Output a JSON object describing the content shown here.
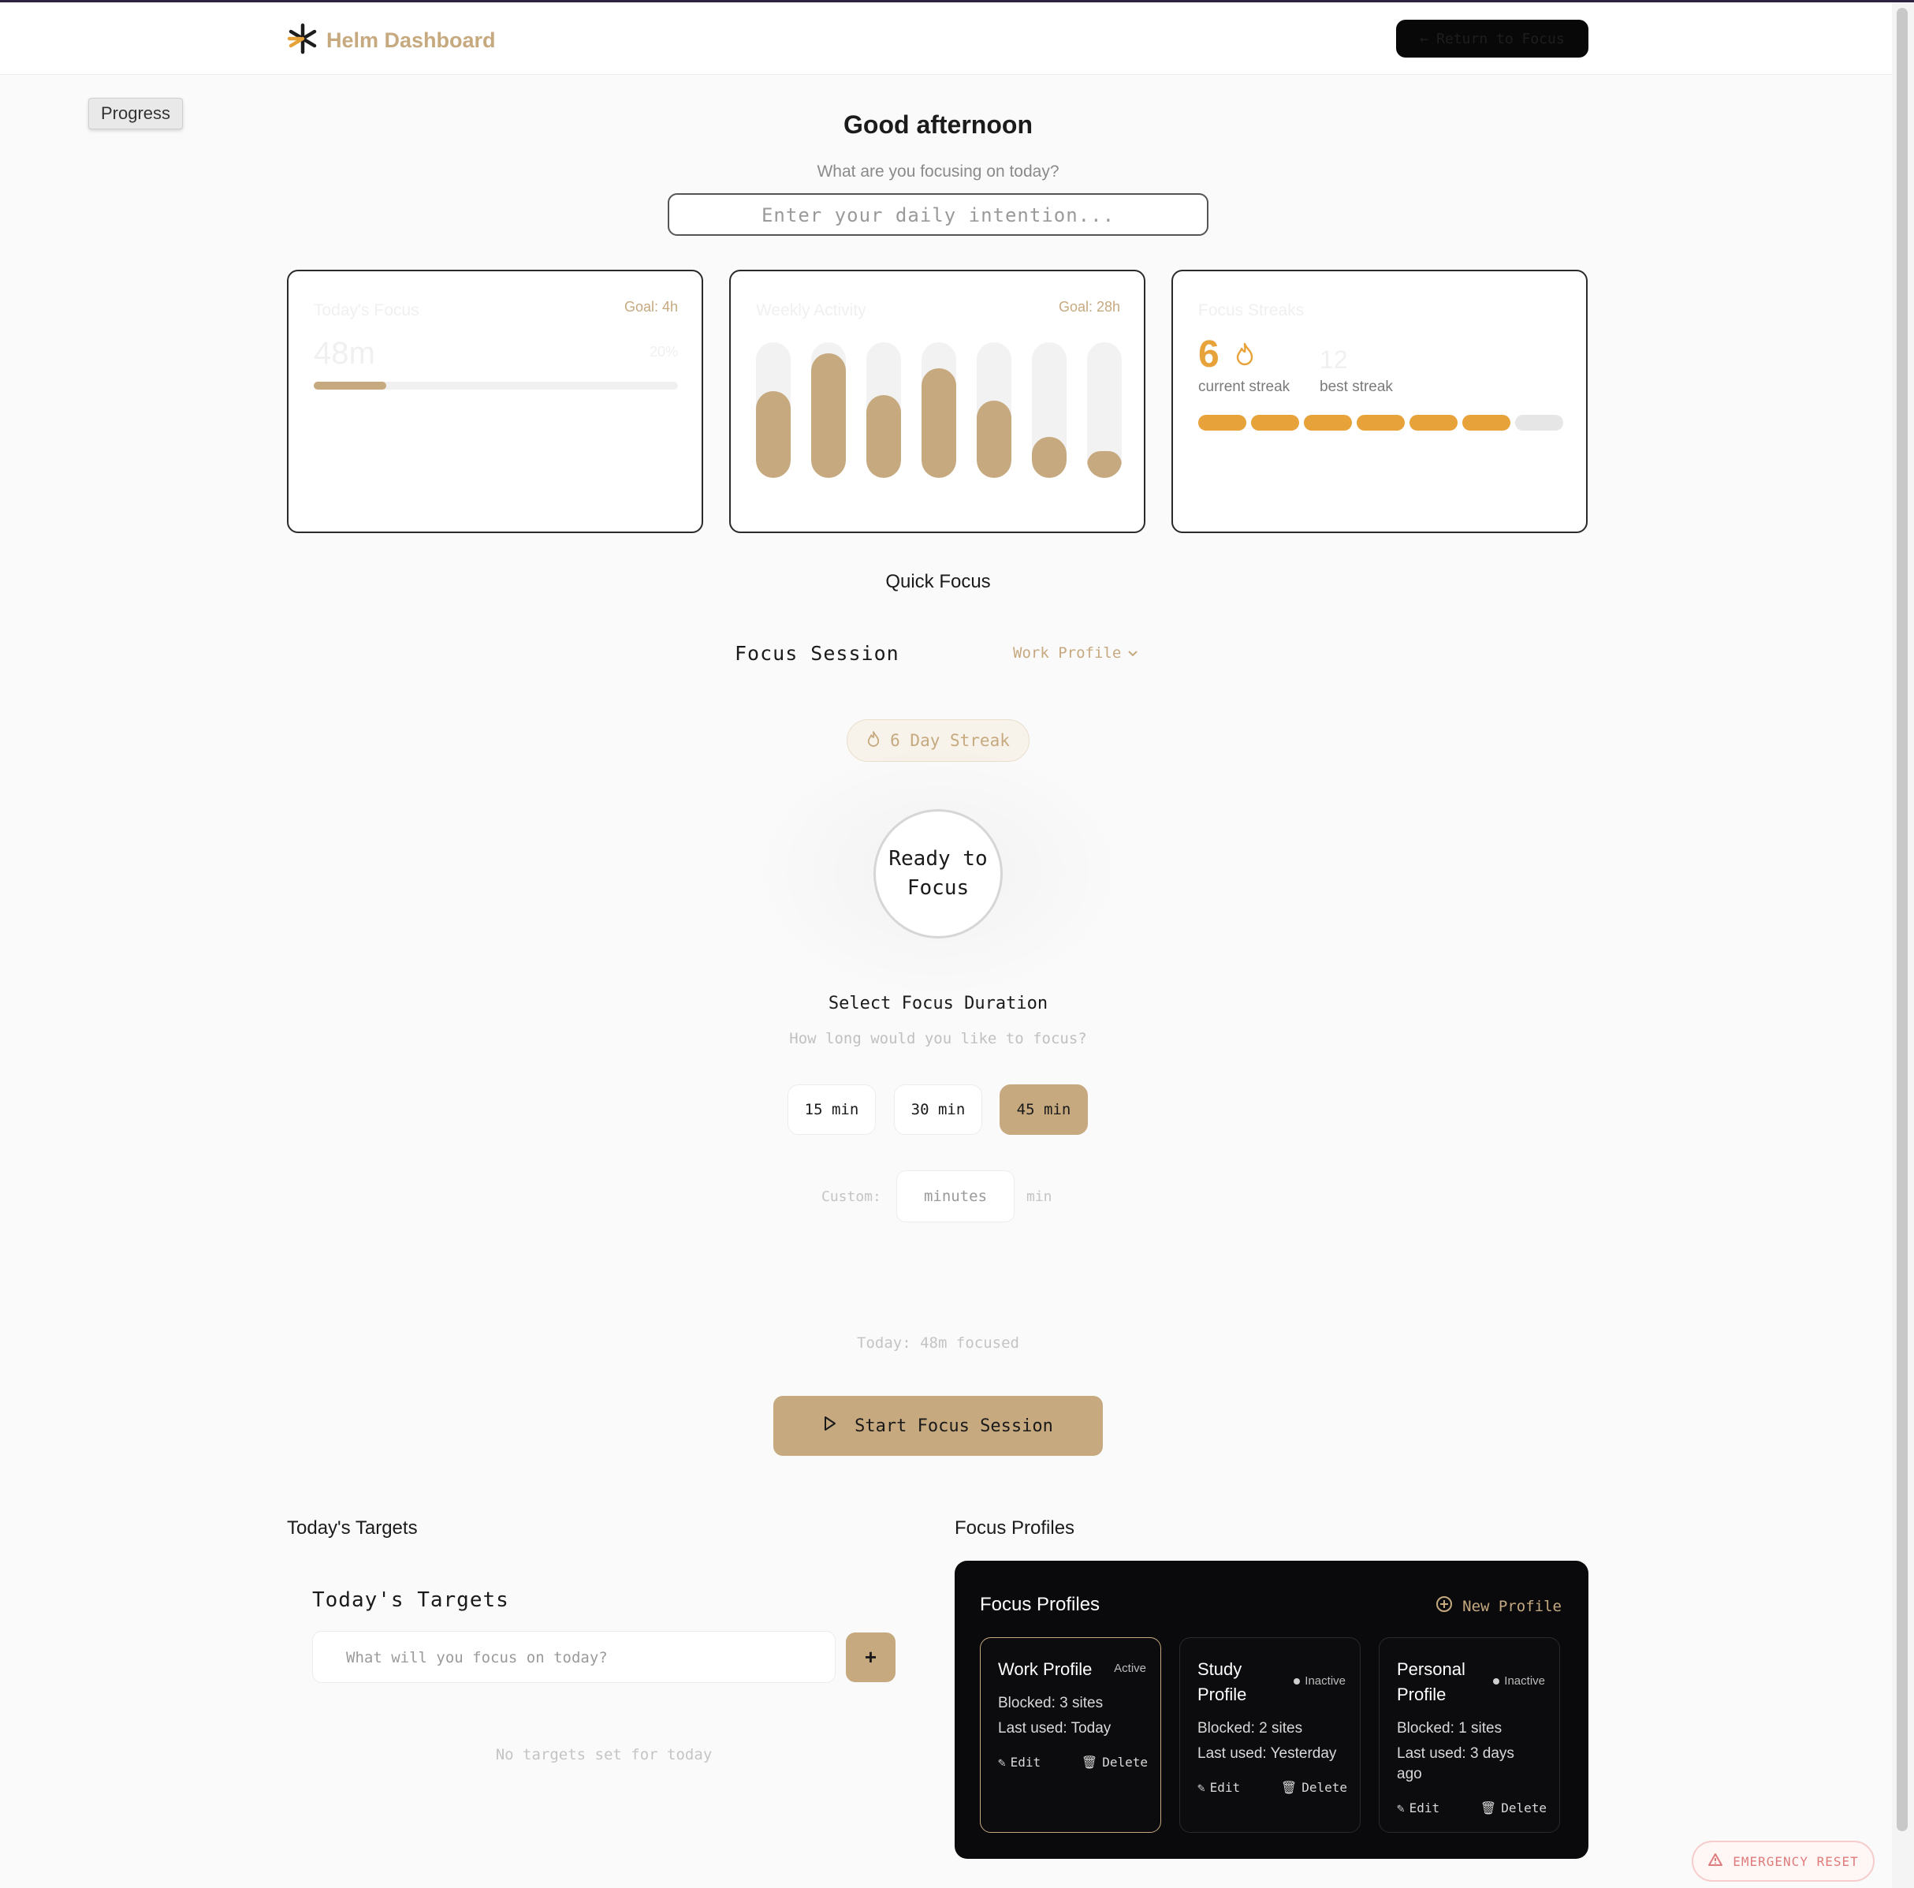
{
  "header": {
    "brand_title": "Helm Dashboard",
    "return_label": "Return to Focus"
  },
  "progress_tag": "Progress",
  "greeting": "Good afternoon",
  "question": "What are you focusing on today?",
  "intention_placeholder": "Enter your daily intention...",
  "cards": {
    "today": {
      "title": "Today's Focus",
      "goal": "Goal: 4h",
      "value": "48m",
      "percent": "20%",
      "progress": 0.2
    },
    "weekly": {
      "title": "Weekly Activity",
      "goal": "Goal: 28h",
      "bars": [
        0.64,
        0.92,
        0.61,
        0.81,
        0.57,
        0.3,
        0.2
      ]
    },
    "streak": {
      "title": "Focus Streaks",
      "current": "6",
      "current_label": "current streak",
      "best": "12",
      "best_label": "best streak",
      "days_filled": 6,
      "days_total": 7,
      "colors": {
        "filled": "#e8a23a",
        "empty": "#e6e6e6"
      }
    }
  },
  "quick_focus": {
    "section_title": "Quick Focus",
    "session_title": "Focus Session",
    "profile_selected": "Work Profile",
    "streak_badge": "6 Day Streak",
    "ready_text": "Ready to Focus",
    "select_title": "Select Focus Duration",
    "select_sub": "How long would you like to focus?",
    "durations": [
      {
        "label": "15 min",
        "active": false
      },
      {
        "label": "30 min",
        "active": false
      },
      {
        "label": "45 min",
        "active": true
      }
    ],
    "custom_label": "Custom:",
    "custom_placeholder": "minutes",
    "custom_unit": "min",
    "today_focused": "Today: 48m focused",
    "start_label": "Start Focus Session"
  },
  "targets": {
    "section_title": "Today's Targets",
    "title": "Today's Targets",
    "input_placeholder": "What will you focus on today?",
    "add_label": "+",
    "empty_text": "No targets set for today"
  },
  "profiles": {
    "section_title": "Focus Profiles",
    "panel_title": "Focus Profiles",
    "new_label": "New Profile",
    "edit_label": "Edit",
    "delete_label": "Delete",
    "items": [
      {
        "name": "Work Profile",
        "status": "Active",
        "blocked": "Blocked: 3 sites",
        "last_used": "Last used: Today"
      },
      {
        "name": "Study Profile",
        "status": "Inactive",
        "blocked": "Blocked: 2 sites",
        "last_used": "Last used: Yesterday"
      },
      {
        "name": "Personal Profile",
        "status": "Inactive",
        "blocked": "Blocked: 1 sites",
        "last_used": "Last used: 3 days ago"
      }
    ]
  },
  "emergency_label": "EMERGENCY RESET",
  "colors": {
    "accent": "#c6a97f",
    "streak": "#e8a23a",
    "dark": "#0a0a0c",
    "danger": "#e07b7b"
  }
}
